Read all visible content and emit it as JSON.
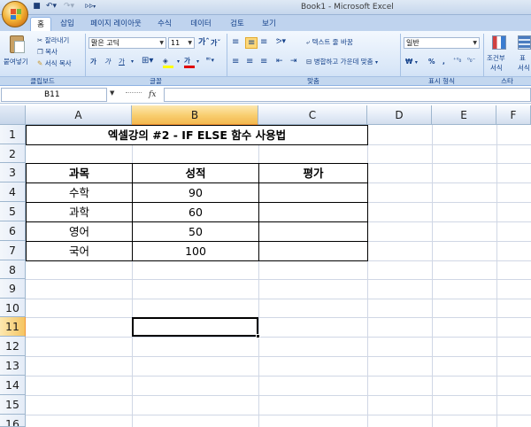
{
  "window": {
    "title": "Book1 - Microsoft Excel"
  },
  "quick_access": {
    "save_icon": "save-icon",
    "undo_icon": "undo-icon",
    "redo_icon": "redo-icon",
    "customize_icon": "customize-qat-icon"
  },
  "tabs": [
    {
      "label": "홈",
      "active": true
    },
    {
      "label": "삽입"
    },
    {
      "label": "페이지 레이아웃"
    },
    {
      "label": "수식"
    },
    {
      "label": "데이터"
    },
    {
      "label": "검토"
    },
    {
      "label": "보기"
    }
  ],
  "ribbon": {
    "clipboard": {
      "label": "클립보드",
      "paste": "붙여넣기",
      "cut": "잘라내기",
      "copy": "복사",
      "format_painter": "서식 복사"
    },
    "font": {
      "label": "글꼴",
      "font_name": "맑은 고딕",
      "font_size": "11",
      "bold": "가",
      "italic": "가",
      "underline": "가"
    },
    "alignment": {
      "label": "맞춤",
      "wrap_text": "텍스트 줄 바꿈",
      "merge_center": "병합하고 가운데 맞춤"
    },
    "number": {
      "label": "표시 형식",
      "format": "일반",
      "currency": "₩",
      "percent": "%"
    },
    "styles": {
      "label": "스타",
      "conditional": "조건부",
      "conditional2": "서식",
      "table": "표",
      "table2": "서식"
    }
  },
  "formula_bar": {
    "name_box": "B11",
    "fx": "fx",
    "formula": ""
  },
  "columns": [
    "A",
    "B",
    "C",
    "D",
    "E",
    "F"
  ],
  "rows": [
    "1",
    "2",
    "3",
    "4",
    "5",
    "6",
    "7",
    "8",
    "9",
    "10",
    "11",
    "12",
    "13",
    "14",
    "15",
    "16"
  ],
  "sheet": {
    "title": "엑셀강의 #2 - IF ELSE 함수 사용법",
    "headers": [
      "과목",
      "성적",
      "평가"
    ],
    "data": [
      {
        "subject": "수학",
        "score": "90",
        "eval": ""
      },
      {
        "subject": "과학",
        "score": "60",
        "eval": ""
      },
      {
        "subject": "영어",
        "score": "50",
        "eval": ""
      },
      {
        "subject": "국어",
        "score": "100",
        "eval": ""
      }
    ]
  },
  "selected": {
    "column": "B",
    "row": "11"
  }
}
